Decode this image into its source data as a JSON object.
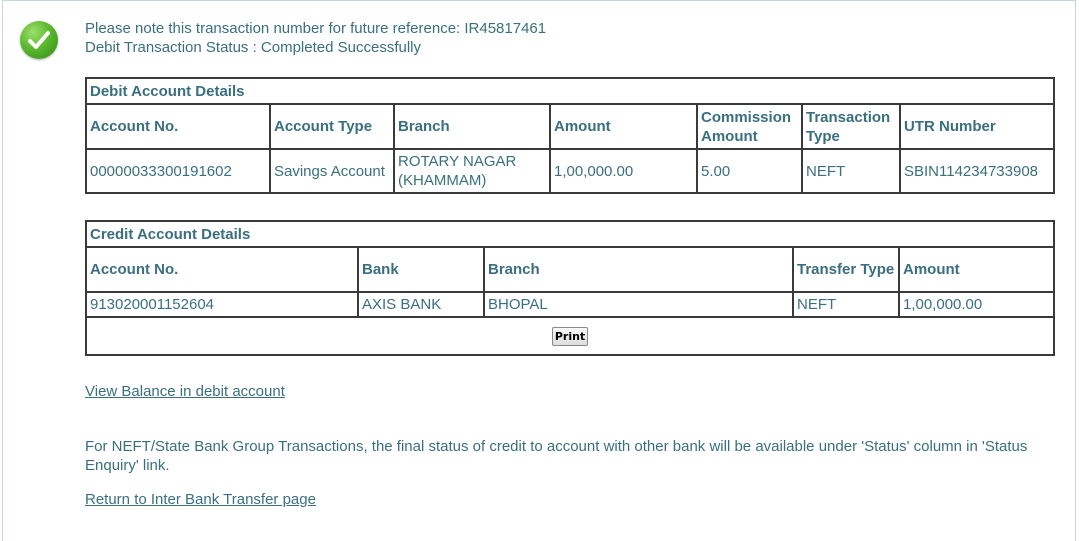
{
  "header": {
    "reference_line": "Please note this transaction number for future reference: IR45817461",
    "status_line": "Debit Transaction Status : Completed Successfully",
    "icon": "checkmark-success-icon"
  },
  "debit": {
    "title": "Debit Account Details",
    "headers": [
      "Account No.",
      "Account Type",
      "Branch",
      "Amount",
      "Commission Amount",
      "Transaction Type",
      "UTR Number"
    ],
    "row": [
      "00000033300191602",
      "Savings Account",
      "ROTARY NAGAR (KHAMMAM)",
      "1,00,000.00",
      "5.00",
      "NEFT",
      "SBIN114234733908"
    ]
  },
  "credit": {
    "title": "Credit Account Details",
    "headers": [
      "Account No.",
      "Bank",
      "Branch",
      "Transfer Type",
      "Amount"
    ],
    "row": [
      "913020001152604",
      "AXIS BANK",
      "BHOPAL",
      "NEFT",
      "1,00,000.00"
    ],
    "print_label": "Print"
  },
  "links": {
    "view_balance": "View Balance in debit account",
    "return_link": "Return to Inter Bank Transfer page"
  },
  "note": "For NEFT/State Bank Group Transactions, the final status of credit to account with other bank will be available under 'Status' column in 'Status Enquiry' link.",
  "colors": {
    "text": "#3a6f7f",
    "border": "#3a3a3a",
    "success": "#5cb82e"
  }
}
